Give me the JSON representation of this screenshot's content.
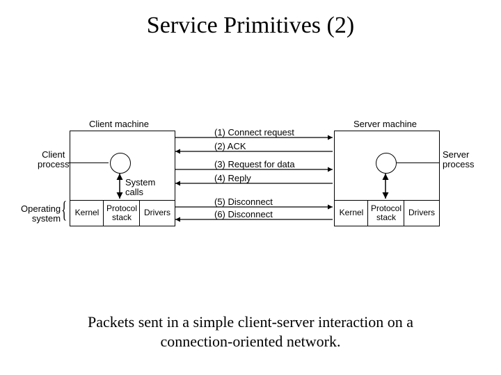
{
  "title": "Service Primitives (2)",
  "caption_line1": "Packets sent in a simple client-server interaction on a",
  "caption_line2": "connection-oriented network.",
  "client": {
    "machine_label": "Client machine",
    "process_label": "Client\nprocess",
    "syscalls_label": "System\ncalls",
    "os_label": "Operating\nsystem",
    "kernel": "Kernel",
    "protocol_stack": "Protocol\nstack",
    "drivers": "Drivers"
  },
  "server": {
    "machine_label": "Server machine",
    "process_label": "Server\nprocess",
    "kernel": "Kernel",
    "protocol_stack": "Protocol\nstack",
    "drivers": "Drivers"
  },
  "messages": [
    "(1) Connect request",
    "(2) ACK",
    "(3) Request for data",
    "(4) Reply",
    "(5) Disconnect",
    "(6) Disconnect"
  ]
}
